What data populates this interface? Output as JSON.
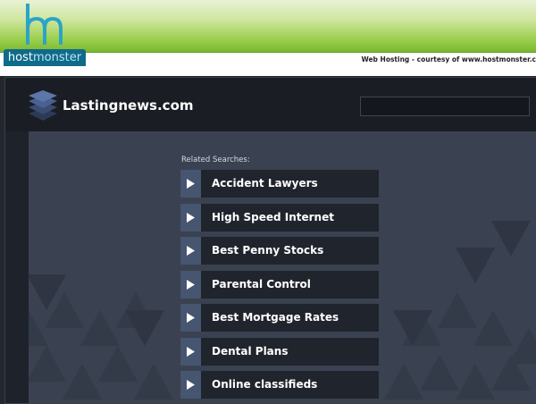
{
  "host_banner": {
    "logo_mark": "hm",
    "logo_text_part1": "host",
    "logo_text_part2": "monster",
    "courtesy_text": "Web Hosting - courtesy of www.hostmonster.c"
  },
  "site": {
    "title": "Lastingnews.com",
    "icon": "stack-layers-icon"
  },
  "related": {
    "label": "Related Searches:",
    "links": [
      {
        "label": "Accident Lawyers"
      },
      {
        "label": "High Speed Internet"
      },
      {
        "label": "Best Penny Stocks"
      },
      {
        "label": "Parental Control"
      },
      {
        "label": "Best Mortgage Rates"
      },
      {
        "label": "Dental Plans"
      },
      {
        "label": "Online classifieds"
      }
    ]
  },
  "colors": {
    "banner_green": "#7ab82f",
    "brand_blue": "#0f6b8a",
    "link_bg": "#20242c",
    "arrow_bg": "#465570"
  }
}
